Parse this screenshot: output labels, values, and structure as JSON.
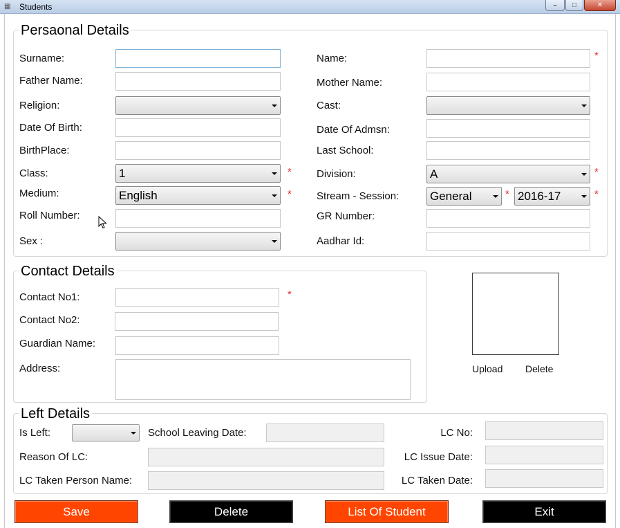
{
  "window": {
    "title": "Students",
    "icon": "app-icon",
    "controls": [
      "minimize-icon",
      "maximize-icon",
      "close-icon"
    ]
  },
  "personal": {
    "legend": "Persaonal Details",
    "surname_label": "Surname:",
    "father_label": "Father Name:",
    "religion_label": "Religion:",
    "dob_label": "Date Of Birth:",
    "birthplace_label": "BirthPlace:",
    "class_label": "Class:",
    "class_value": "1",
    "medium_label": "Medium:",
    "medium_value": "English",
    "roll_label": "Roll Number:",
    "sex_label": "Sex :",
    "name_label": "Name:",
    "mother_label": "Mother Name:",
    "cast_label": "Cast:",
    "admsn_label": "Date Of Admsn:",
    "lastschool_label": "Last School:",
    "division_label": "Division:",
    "division_value": "A",
    "stream_label": "Stream - Session:",
    "stream_value": "General",
    "session_value": "2016-17",
    "gr_label": "GR Number:",
    "aadhar_label": "Aadhar Id:",
    "required_mark": "*"
  },
  "contact": {
    "legend": "Contact Details",
    "no1_label": "Contact No1:",
    "no2_label": "Contact No2:",
    "guardian_label": "Guardian Name:",
    "address_label": "Address:"
  },
  "photo": {
    "upload_label": "Upload",
    "delete_label": "Delete"
  },
  "left": {
    "legend": "Left Details",
    "isleft_label": "Is Left:",
    "leaving_date_label": "School Leaving Date:",
    "lcno_label": "LC No:",
    "reason_label": "Reason Of LC:",
    "issue_date_label": "LC Issue Date:",
    "taken_person_label": "LC Taken Person Name:",
    "taken_date_label": "LC Taken Date:"
  },
  "actions": {
    "save": "Save",
    "delete": "Delete",
    "list": "List Of Student",
    "exit": "Exit"
  },
  "colors": {
    "accent_orange": "#ff4500",
    "button_black": "#000000",
    "required_red": "#e03131"
  }
}
